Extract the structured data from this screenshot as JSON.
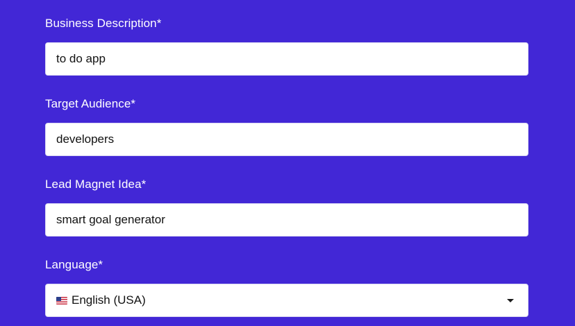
{
  "form": {
    "business_description": {
      "label": "Business Description*",
      "value": "to do app"
    },
    "target_audience": {
      "label": "Target Audience*",
      "value": "developers"
    },
    "lead_magnet_idea": {
      "label": "Lead Magnet Idea*",
      "value": "smart goal generator"
    },
    "language": {
      "label": "Language*",
      "selected": "English (USA)",
      "flag_icon": "us-flag-icon",
      "dropdown_icon": "caret-down-icon"
    }
  },
  "colors": {
    "background": "#4227d6",
    "label_text": "#ffffff",
    "input_background": "#ffffff",
    "input_text": "#111111"
  }
}
